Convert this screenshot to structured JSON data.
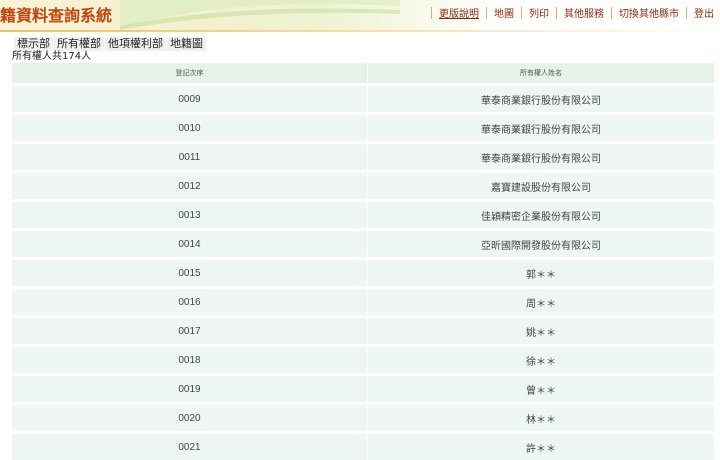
{
  "header": {
    "title": "籍資料查詢系統",
    "nav": [
      "更版說明",
      "地圖",
      "列印",
      "其他服務",
      "切換其他縣市",
      "登出"
    ]
  },
  "tabs": [
    "標示部",
    "所有權部",
    "他項權利部",
    "地籍圖"
  ],
  "owner_count_text": "所有權人共174人",
  "table": {
    "headers": [
      "登記次序",
      "所有權人姓名"
    ],
    "rows": [
      {
        "seq": "0009",
        "name": "華泰商業銀行股份有限公司"
      },
      {
        "seq": "0010",
        "name": "華泰商業銀行股份有限公司"
      },
      {
        "seq": "0011",
        "name": "華泰商業銀行股份有限公司"
      },
      {
        "seq": "0012",
        "name": "嘉寶建設股份有限公司"
      },
      {
        "seq": "0013",
        "name": "佳穎精密企業股份有限公司"
      },
      {
        "seq": "0014",
        "name": "亞昕國際開發股份有限公司"
      },
      {
        "seq": "0015",
        "name": "郭＊＊"
      },
      {
        "seq": "0016",
        "name": "周＊＊"
      },
      {
        "seq": "0017",
        "name": "姚＊＊"
      },
      {
        "seq": "0018",
        "name": "徐＊＊"
      },
      {
        "seq": "0019",
        "name": "曾＊＊"
      },
      {
        "seq": "0020",
        "name": "林＊＊"
      },
      {
        "seq": "0021",
        "name": "許＊＊"
      }
    ]
  },
  "colors": {
    "title": "#c2460f",
    "nav_link": "#8a2a0a",
    "table_header_bg": "#e4f2e8",
    "table_row_bg": "#edf6f3"
  }
}
